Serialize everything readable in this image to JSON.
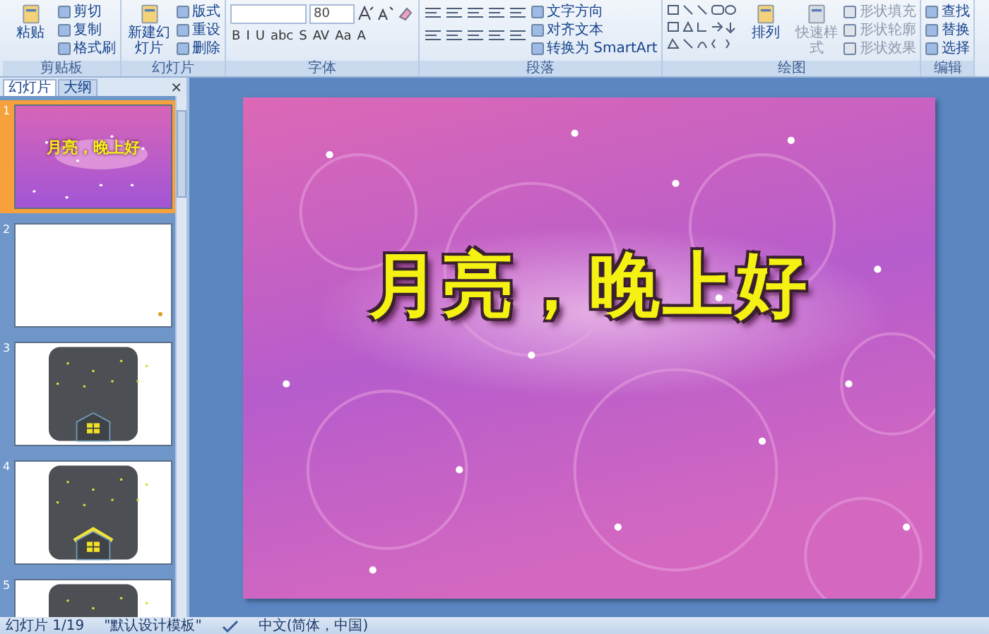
{
  "ribbon": {
    "groups": [
      {
        "label": "剪贴板",
        "columns": [
          [
            {
              "kind": "large",
              "label": "粘贴",
              "disabled": false
            }
          ],
          [
            {
              "kind": "small",
              "label": "剪切",
              "disabled": false
            },
            {
              "kind": "small",
              "label": "复制",
              "disabled": false
            },
            {
              "kind": "small",
              "label": "格式刷",
              "disabled": false
            }
          ]
        ]
      },
      {
        "label": "幻灯片",
        "columns": [
          [
            {
              "kind": "large",
              "label": "新建幻灯片",
              "disabled": false
            }
          ],
          [
            {
              "kind": "small",
              "label": "版式",
              "disabled": false
            },
            {
              "kind": "small",
              "label": "重设",
              "disabled": false
            },
            {
              "kind": "small",
              "label": "删除",
              "disabled": false
            }
          ]
        ]
      },
      {
        "label": "字体",
        "columns": [
          [
            {
              "kind": "fontrow",
              "size": "80"
            },
            {
              "kind": "tools",
              "buttons": [
                "B",
                "I",
                "U",
                "abc",
                "S",
                "AV",
                "Aa",
                "A"
              ]
            }
          ]
        ]
      },
      {
        "label": "段落",
        "columns": [
          [
            {
              "kind": "iconrow"
            },
            {
              "kind": "iconrow"
            }
          ],
          [
            {
              "kind": "small",
              "label": "文字方向",
              "disabled": false
            },
            {
              "kind": "small",
              "label": "对齐文本",
              "disabled": false
            },
            {
              "kind": "small",
              "label": "转换为 SmartArt",
              "disabled": false
            }
          ]
        ]
      },
      {
        "label": "绘图",
        "columns": [
          [
            {
              "kind": "shapes"
            }
          ],
          [
            {
              "kind": "large",
              "label": "排列",
              "disabled": false
            }
          ],
          [
            {
              "kind": "large",
              "label": "快速样式",
              "disabled": true
            }
          ],
          [
            {
              "kind": "small",
              "label": "形状填充",
              "disabled": true
            },
            {
              "kind": "small",
              "label": "形状轮廓",
              "disabled": true
            },
            {
              "kind": "small",
              "label": "形状效果",
              "disabled": true
            }
          ]
        ]
      },
      {
        "label": "编辑",
        "columns": [
          [
            {
              "kind": "small",
              "label": "查找",
              "disabled": false
            },
            {
              "kind": "small",
              "label": "替换",
              "disabled": false
            },
            {
              "kind": "small",
              "label": "选择",
              "disabled": false
            }
          ]
        ]
      }
    ]
  },
  "panel": {
    "tabs": [
      {
        "label": "幻灯片",
        "selected": true
      },
      {
        "label": "大纲",
        "selected": false
      }
    ],
    "close": "×"
  },
  "thumbnails": [
    {
      "number": "1",
      "kind": "title",
      "title": "月亮，晚上好",
      "selected": true
    },
    {
      "number": "2",
      "kind": "blank",
      "selected": false
    },
    {
      "number": "3",
      "kind": "night",
      "selected": false
    },
    {
      "number": "4",
      "kind": "glow",
      "selected": false
    },
    {
      "number": "5",
      "kind": "night",
      "selected": false
    }
  ],
  "slide": {
    "title": "月亮，晚上好"
  },
  "status_bar": {
    "slide": "幻灯片 1/19",
    "theme": "\"默认设计模板\"",
    "language": "中文(简体，中国)"
  }
}
